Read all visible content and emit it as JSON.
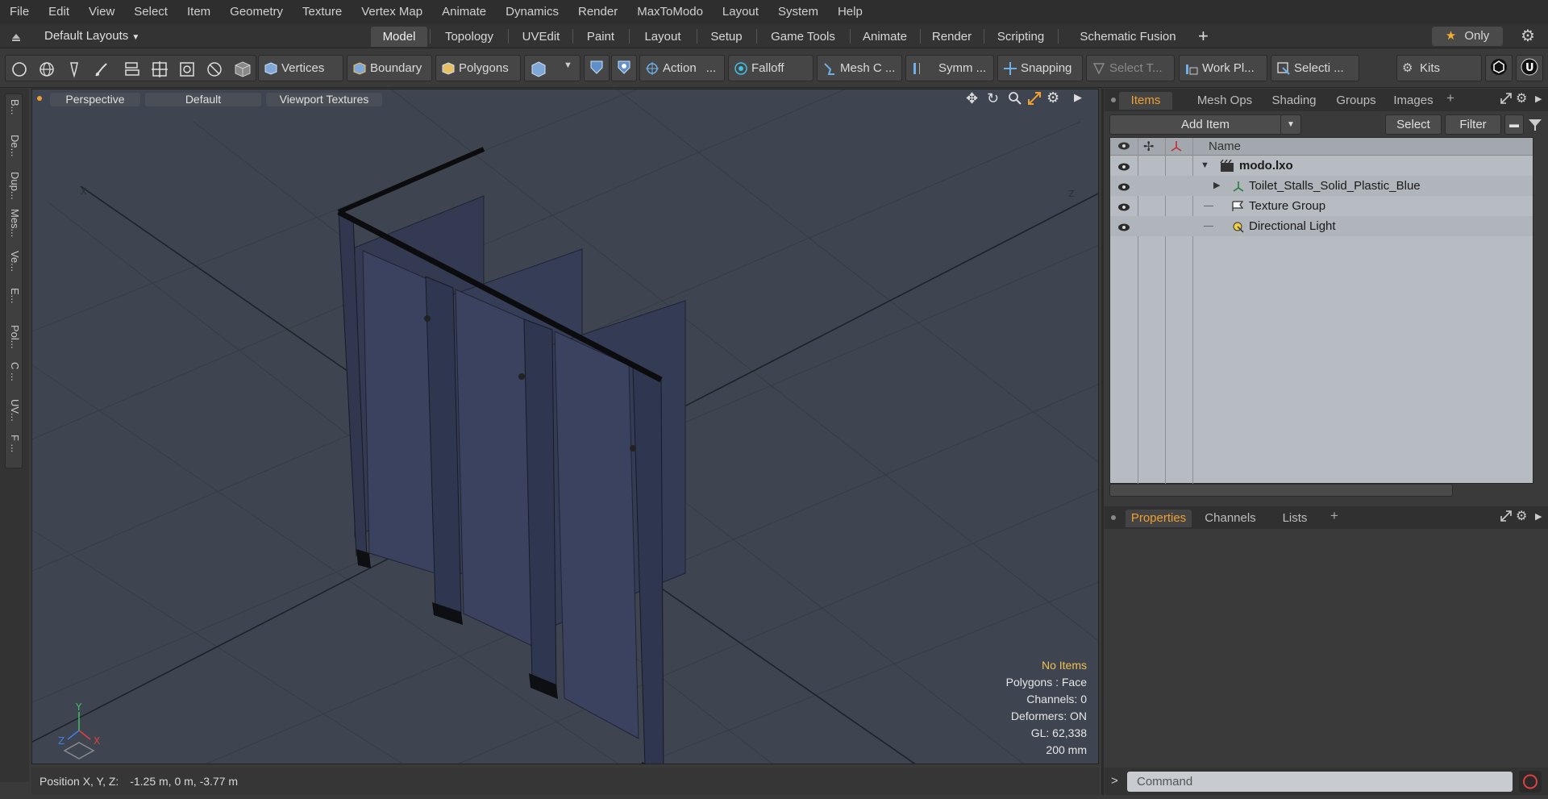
{
  "menubar": [
    "File",
    "Edit",
    "View",
    "Select",
    "Item",
    "Geometry",
    "Texture",
    "Vertex Map",
    "Animate",
    "Dynamics",
    "Render",
    "MaxToModo",
    "Layout",
    "System",
    "Help"
  ],
  "layoutbar": {
    "layouts_label": "Default Layouts",
    "tabs": [
      "Model",
      "Topology",
      "UVEdit",
      "Paint",
      "Layout",
      "Setup",
      "Game Tools",
      "Animate",
      "Render",
      "Scripting",
      "Schematic Fusion"
    ],
    "active_tab": "Model",
    "only_label": "Only"
  },
  "toolbar": {
    "vertices": "Vertices",
    "boundary": "Boundary",
    "polygons": "Polygons",
    "action": "Action",
    "action_more": "...",
    "falloff": "Falloff",
    "mesh_c": "Mesh C ...",
    "symm": "Symm ...",
    "snapping": "Snapping",
    "select_t": "Select T...",
    "work_pl": "Work Pl...",
    "selecti": "Selecti ...",
    "kits": "Kits"
  },
  "lefttabs": [
    "B...",
    "De...",
    "Dup...",
    "Mes...",
    "Ve...",
    "E...",
    "Pol...",
    "C ...",
    "UV...",
    "F ..."
  ],
  "viewport": {
    "view_mode": "Perspective",
    "shading": "Default",
    "textures": "Viewport Textures",
    "info": {
      "selection": "No Items",
      "polygons": "Polygons : Face",
      "channels": "Channels: 0",
      "deformers": "Deformers: ON",
      "gl": "GL: 62,338",
      "scale": "200 mm"
    },
    "axis_x": "X",
    "axis_y": "Y",
    "axis_z": "Z"
  },
  "statusbar": {
    "label": "Position X, Y, Z:",
    "value": "-1.25 m, 0 m, -3.77 m"
  },
  "items_panel": {
    "tabs": [
      "Items",
      "Mesh Ops",
      "Shading",
      "Groups",
      "Images"
    ],
    "active_tab": "Items",
    "add_item": "Add Item",
    "select": "Select",
    "filter": "Filter",
    "column_name": "Name",
    "rows": [
      {
        "label": "modo.lxo",
        "bold": true
      },
      {
        "label": "Toilet_Stalls_Solid_Plastic_Blue",
        "bold": false
      },
      {
        "label": "Texture Group",
        "bold": false
      },
      {
        "label": "Directional Light",
        "bold": false
      }
    ]
  },
  "properties_panel": {
    "tabs": [
      "Properties",
      "Channels",
      "Lists"
    ],
    "active_tab": "Properties"
  },
  "command": {
    "prompt": ">",
    "placeholder": "Command"
  },
  "colors": {
    "accent": "#f0a030",
    "viewport_bg": "#3f4550",
    "stall_panel": "#39405a",
    "item_list_bg": "#b7bcc2"
  }
}
